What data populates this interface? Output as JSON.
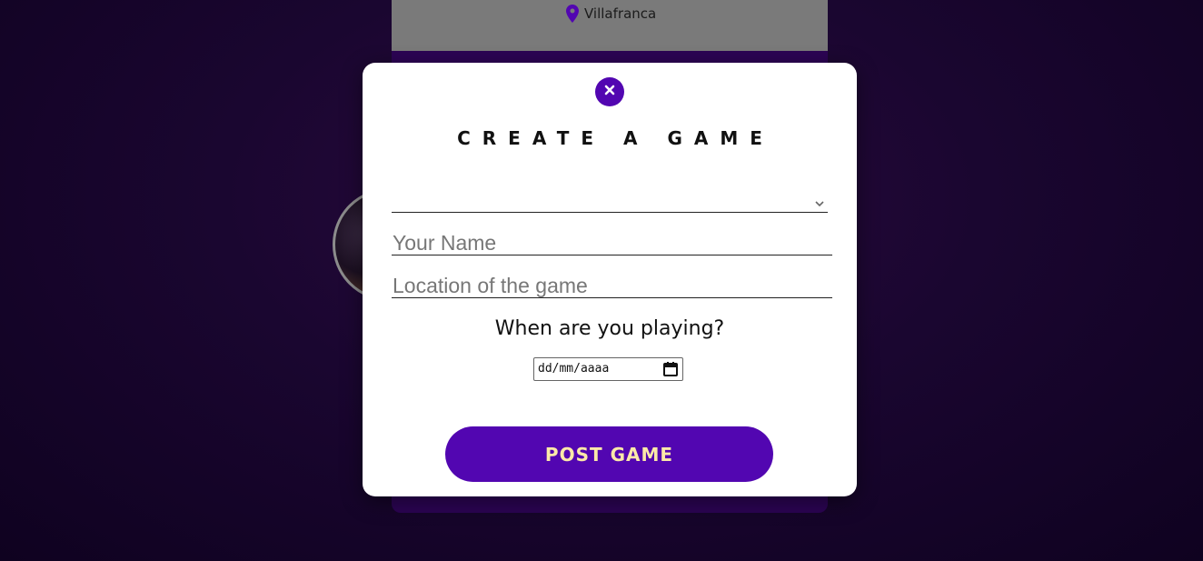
{
  "background_card": {
    "location_icon": "map-pin-icon",
    "location": "Villafranca"
  },
  "modal": {
    "close_icon": "close-icon",
    "title": "CREATE A GAME",
    "game_select": {
      "selected_value": ""
    },
    "name_input": {
      "placeholder": "Your Name",
      "value": ""
    },
    "location_input": {
      "placeholder": "Location of the game",
      "value": ""
    },
    "when_label": "When are you playing?",
    "date_input": {
      "display": "dd/mm/aaaa"
    },
    "post_button_label": "POST GAME"
  },
  "colors": {
    "accent": "#5206b1",
    "button_text": "#fbe9a8",
    "background_dark": "#1a0630",
    "card_header": "#7a7a7a"
  }
}
